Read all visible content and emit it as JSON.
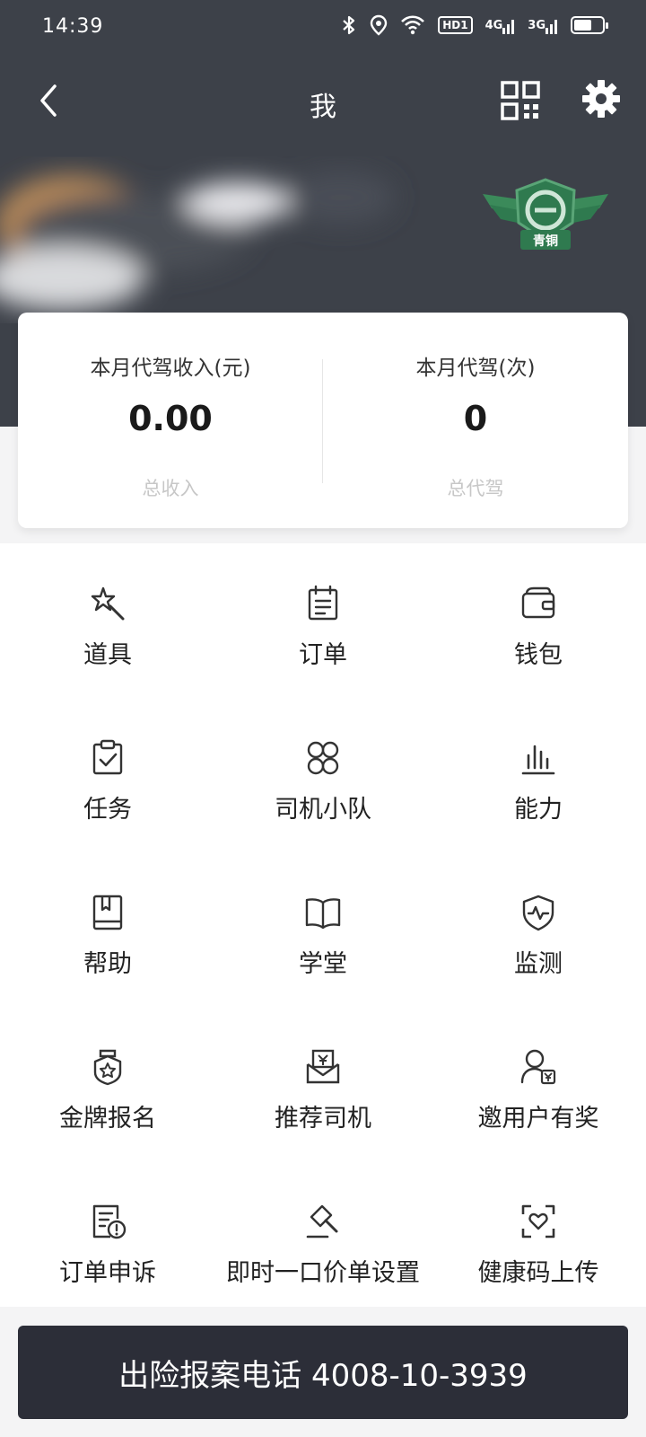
{
  "status_bar": {
    "time": "14:39",
    "icons": [
      "bluetooth-icon",
      "location-icon",
      "wifi-icon",
      "hd-icon",
      "signal-4g-icon",
      "signal-3g-icon",
      "battery-icon"
    ],
    "hd_label": "HD1",
    "net1_label": "4G",
    "net2_label": "3G"
  },
  "header": {
    "title": "我",
    "bg_color": "#3d4149",
    "level_badge": "青铜",
    "badge_color": "#2f7a4f"
  },
  "stats": {
    "monthly_income_label": "本月代驾收入(元)",
    "monthly_income_value": "0.00",
    "total_income_label": "总收入",
    "monthly_trips_label": "本月代驾(次)",
    "monthly_trips_value": "0",
    "total_trips_label": "总代驾"
  },
  "menu": [
    {
      "label": "道具",
      "icon": "magic-wand-icon"
    },
    {
      "label": "订单",
      "icon": "order-icon"
    },
    {
      "label": "钱包",
      "icon": "wallet-icon"
    },
    {
      "label": "任务",
      "icon": "task-icon"
    },
    {
      "label": "司机小队",
      "icon": "team-icon"
    },
    {
      "label": "能力",
      "icon": "ability-chart-icon"
    },
    {
      "label": "帮助",
      "icon": "help-book-icon"
    },
    {
      "label": "学堂",
      "icon": "open-book-icon"
    },
    {
      "label": "监测",
      "icon": "shield-monitor-icon"
    },
    {
      "label": "金牌报名",
      "icon": "medal-icon"
    },
    {
      "label": "推荐司机",
      "icon": "recommend-envelope-icon"
    },
    {
      "label": "邀用户有奖",
      "icon": "invite-user-icon"
    },
    {
      "label": "订单申诉",
      "icon": "appeal-icon"
    },
    {
      "label": "即时一口价单设置",
      "icon": "auction-hammer-icon"
    },
    {
      "label": "健康码上传",
      "icon": "health-scan-icon"
    }
  ],
  "footer": {
    "hotline_label": "出险报案电话 4008-10-3939",
    "button_color": "#2c2e38"
  }
}
